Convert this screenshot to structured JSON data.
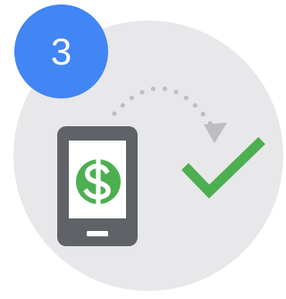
{
  "step": {
    "number": "3"
  },
  "colors": {
    "badge": "#4285f4",
    "background_circle": "#e8e8ea",
    "phone_body": "#5f6368",
    "phone_screen": "#ffffff",
    "money_coin": "#4caf50",
    "checkmark": "#4caf50",
    "arrow": "#bdbdc2"
  },
  "icons": {
    "phone": "smartphone-icon",
    "money": "dollar-coin-icon",
    "arrow": "dotted-curved-arrow-icon",
    "check": "checkmark-icon"
  }
}
